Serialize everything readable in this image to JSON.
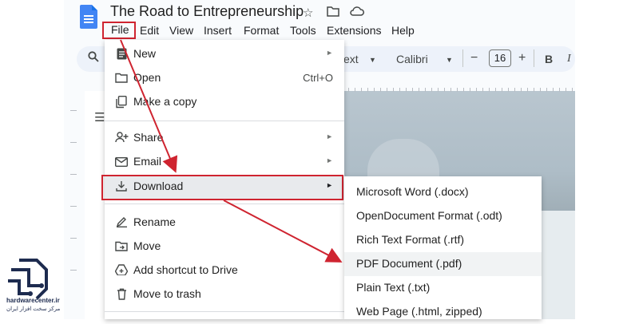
{
  "app": {
    "title": "The Road to Entrepreneurship",
    "menubar": [
      "File",
      "Edit",
      "View",
      "Insert",
      "Format",
      "Tools",
      "Extensions",
      "Help"
    ]
  },
  "toolbar": {
    "style_partial": "ext",
    "font": "Calibri",
    "font_size": "16",
    "minus": "−",
    "plus": "+",
    "bold": "B"
  },
  "file_menu": {
    "items": [
      {
        "label": "New",
        "icon": "new-doc-icon",
        "submenu": true
      },
      {
        "label": "Open",
        "icon": "folder-icon",
        "shortcut": "Ctrl+O"
      },
      {
        "label": "Make a copy",
        "icon": "copy-icon"
      },
      {
        "label": "Share",
        "icon": "share-icon",
        "submenu": true
      },
      {
        "label": "Email",
        "icon": "email-icon",
        "submenu": true
      },
      {
        "label": "Download",
        "icon": "download-icon",
        "submenu": true,
        "active": true
      },
      {
        "label": "Rename",
        "icon": "rename-icon"
      },
      {
        "label": "Move",
        "icon": "move-icon"
      },
      {
        "label": "Add shortcut to Drive",
        "icon": "drive-shortcut-icon"
      },
      {
        "label": "Move to trash",
        "icon": "trash-icon"
      }
    ]
  },
  "download_submenu": {
    "items": [
      {
        "label": "Microsoft Word (.docx)"
      },
      {
        "label": "OpenDocument Format (.odt)"
      },
      {
        "label": "Rich Text Format (.rtf)"
      },
      {
        "label": "PDF Document (.pdf)",
        "hovered": true
      },
      {
        "label": "Plain Text (.txt)"
      },
      {
        "label": "Web Page (.html, zipped)"
      }
    ]
  },
  "watermark": {
    "site": "hardwarecenter.ir",
    "tagline": "مرکز سخت افزار ایران"
  },
  "colors": {
    "highlight": "#cf2430",
    "docs_blue": "#4285f4",
    "toolbar_bg": "#edf2fa",
    "watermark": "#1d2b4f"
  }
}
